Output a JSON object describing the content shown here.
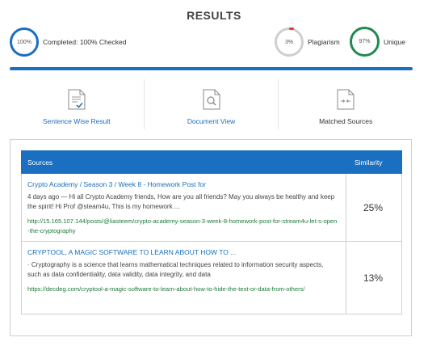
{
  "title": "RESULTS",
  "stats": {
    "completed": {
      "ring_text": "100%",
      "label": "Completed: 100% Checked"
    },
    "plagiarism": {
      "ring_text": "3%",
      "label": "Plagiarism"
    },
    "unique": {
      "ring_text": "97%",
      "label": "Unique"
    }
  },
  "views": {
    "sentence": "Sentence Wise Result",
    "document": "Document View",
    "matched": "Matched Sources"
  },
  "table": {
    "headers": {
      "sources": "Sources",
      "similarity": "Similarity"
    },
    "rows": [
      {
        "title": "Crypto Academy / Season 3 / Week 8 - Homework Post for",
        "snippet": "4 days ago — Hi all Crypto Academy friends, How are you all friends? May you always be healthy and keep the spirit! Hi Prof @steam4u, This is my homework ...",
        "url": "http://15.165.107.144/posts/@liasteem/crypto-academy-season-3-week-8-homework-post-for-stream4u-let-s-open-the-cryptography",
        "similarity": "25%"
      },
      {
        "title": "CRYPTOOL, A MAGIC SOFTWARE TO LEARN ABOUT HOW TO ...",
        "snippet": "· Cryptography is a science that learns mathematical techniques related to information security aspects, such as data confidentiality, data validity, data integrity, and data",
        "url": "https://decdeg.com/cryptool-a-magic-software-to-learn-about-how-to-hide-the-text-or-data-from-others/",
        "similarity": "13%"
      }
    ]
  },
  "colors": {
    "accent": "#1a6fc0",
    "unique": "#1f8a4d",
    "plagiarism": "#e23b3b",
    "url": "#1f7a3a"
  }
}
